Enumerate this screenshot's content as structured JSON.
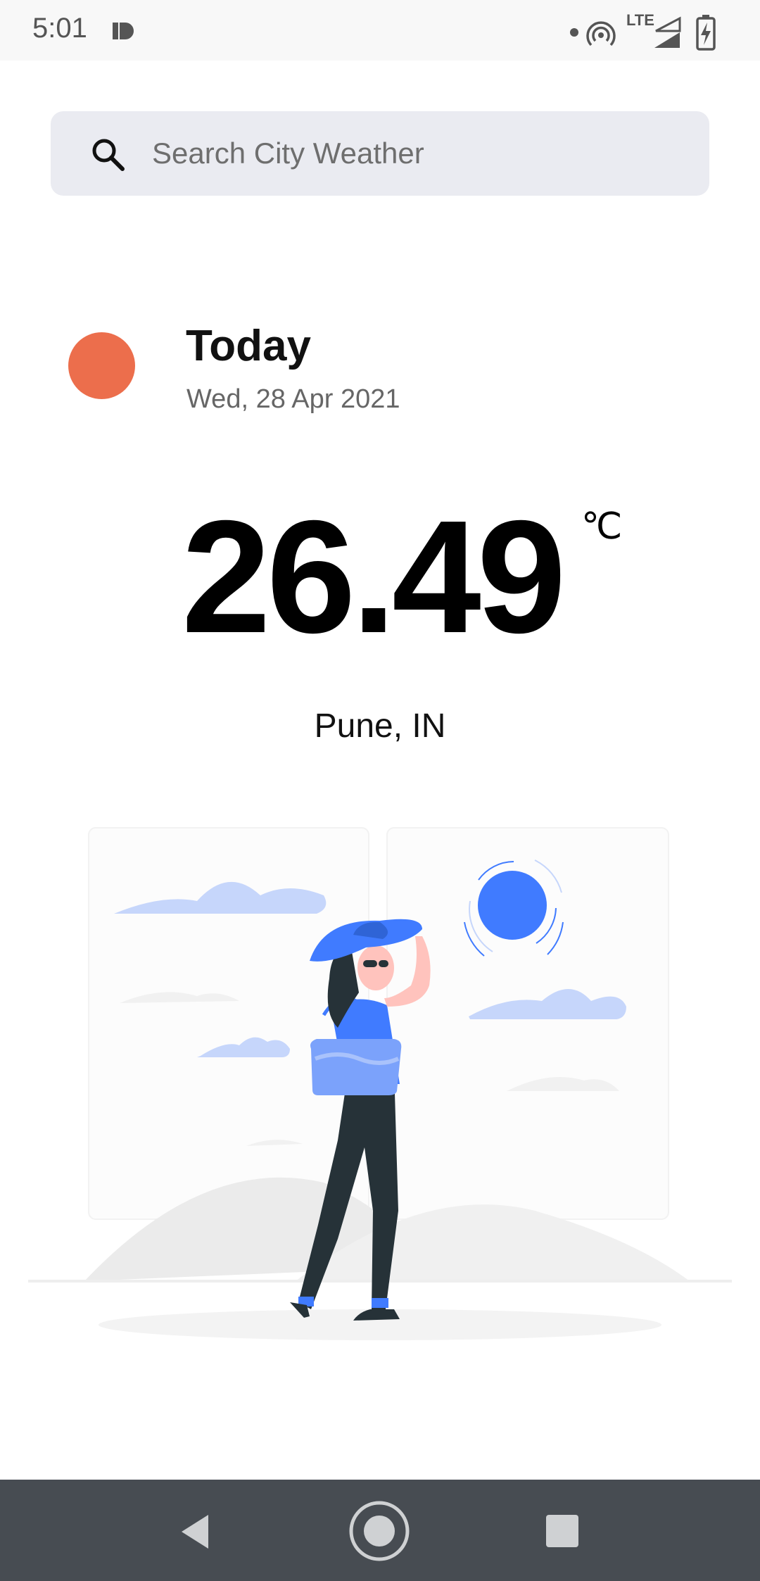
{
  "status_bar": {
    "time": "5:01",
    "network_label": "LTE",
    "icons": [
      "notification-icon",
      "hotspot-icon",
      "signal-icon",
      "battery-charging-icon"
    ]
  },
  "search": {
    "placeholder": "Search City Weather",
    "value": ""
  },
  "weather": {
    "heading": "Today",
    "date": "Wed, 28 Apr 2021",
    "temperature": "26.49",
    "unit": "℃",
    "location": "Pune, IN",
    "indicator_color": "#ec6e4c"
  },
  "colors": {
    "accent_blue": "#407bff",
    "search_bg": "#eaebf1",
    "nav_bg": "#474c52"
  },
  "navigation": {
    "icons": [
      "back-icon",
      "home-icon",
      "recents-icon"
    ]
  }
}
